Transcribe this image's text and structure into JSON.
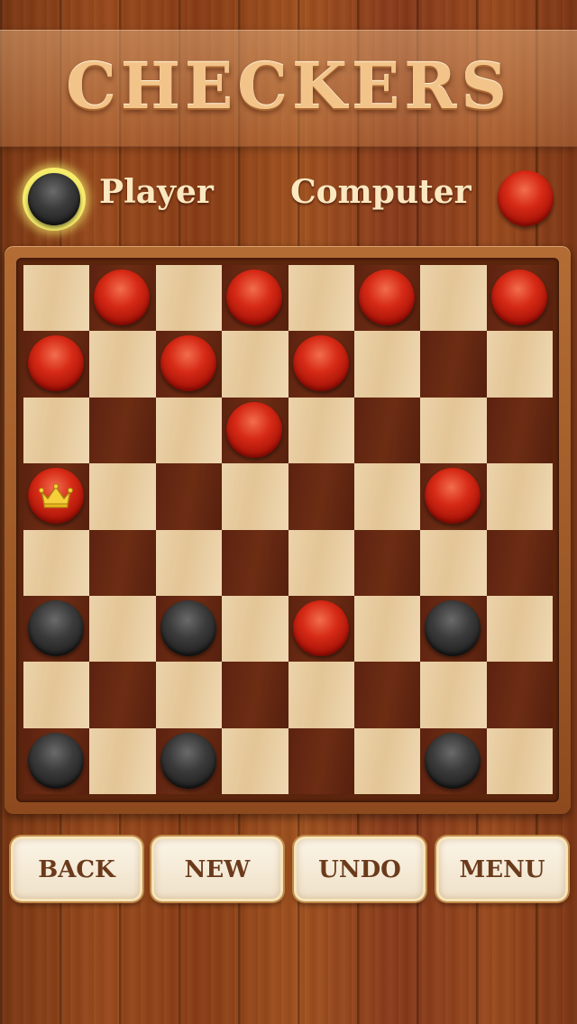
{
  "header": {
    "title": "CHECKERS"
  },
  "players": {
    "player_label": "Player",
    "computer_label": "Computer",
    "player_color": "black",
    "computer_color": "red",
    "current_turn": "Player"
  },
  "board": {
    "size": 8,
    "top_left_square": "light",
    "rows": [
      [
        null,
        "red",
        null,
        "red",
        null,
        "red",
        null,
        "red"
      ],
      [
        "red",
        null,
        "red",
        null,
        "red",
        null,
        null,
        null
      ],
      [
        null,
        null,
        null,
        "red",
        null,
        null,
        null,
        null
      ],
      [
        "red-king",
        null,
        null,
        null,
        null,
        null,
        "red",
        null
      ],
      [
        null,
        null,
        null,
        null,
        null,
        null,
        null,
        null
      ],
      [
        "black",
        null,
        "black",
        null,
        "red",
        null,
        "black",
        null
      ],
      [
        null,
        null,
        null,
        null,
        null,
        null,
        null,
        null
      ],
      [
        "black",
        null,
        "black",
        null,
        null,
        null,
        "black",
        null
      ]
    ]
  },
  "buttons": {
    "back": "BACK",
    "new": "NEW",
    "undo": "UNDO",
    "menu": "MENU"
  },
  "colors": {
    "red_piece": "#d62a16",
    "black_piece": "#2b2b2b",
    "light_square": "#e9cfa3",
    "dark_square": "#652912",
    "turn_highlight": "#f7ec6a"
  },
  "icons": {
    "king_marker": "crown-icon"
  }
}
